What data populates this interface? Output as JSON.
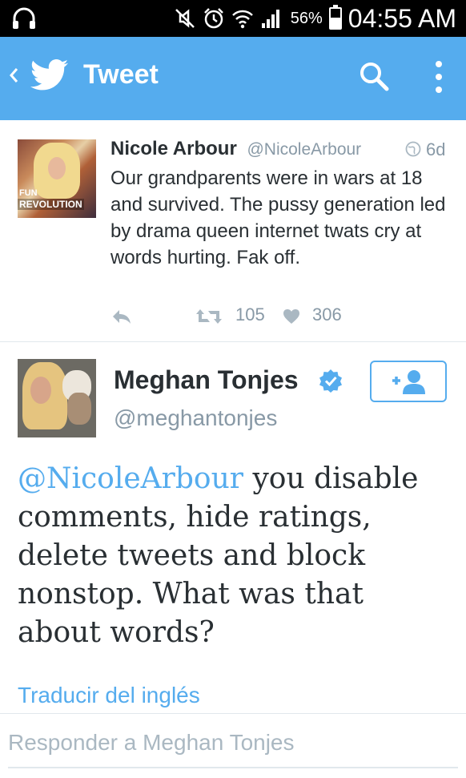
{
  "status_bar": {
    "battery_percent": "56%",
    "battery_level": 0.56,
    "time": "04:55 AM",
    "icons": [
      "headphones-icon",
      "mute-icon",
      "alarm-icon",
      "wifi-icon",
      "signal-icon",
      "battery-icon"
    ]
  },
  "app_bar": {
    "title": "Tweet",
    "icons": [
      "back-chevron-icon",
      "twitter-bird-icon",
      "search-icon",
      "more-vert-icon"
    ],
    "color": "#55acee"
  },
  "previous_tweet": {
    "name": "Nicole Arbour",
    "handle": "@NicoleArbour",
    "age": "6d",
    "avatar_text_top": "FUN",
    "avatar_text_bottom": "REVOLUTION",
    "text": "Our grandparents were in wars at 18 and survived. The pussy generation led by drama queen internet twats cry at words hurting. Fak off.",
    "retweets": "105",
    "likes": "306"
  },
  "main_tweet": {
    "name": "Meghan Tonjes",
    "handle": "@meghantonjes",
    "mention": "@NicoleArbour",
    "text": " you disable comments, hide ratings, delete tweets and block nonstop. What was that about words?",
    "translate_label": "Traducir del inglés"
  },
  "reply": {
    "placeholder": "Responder a Meghan Tonjes"
  }
}
